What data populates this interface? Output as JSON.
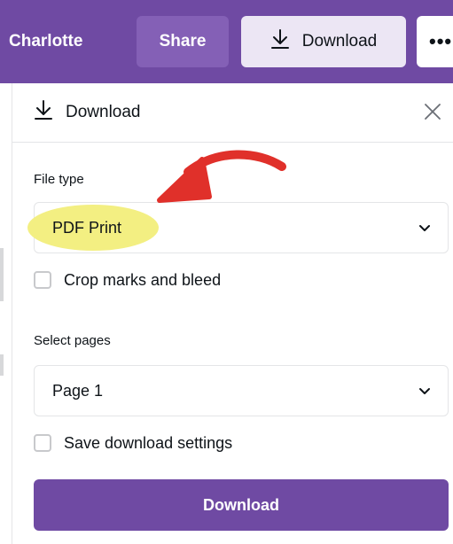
{
  "toolbar": {
    "user_label": "Charlotte",
    "share_label": "Share",
    "download_label": "Download",
    "more_label": "•••",
    "download_icon": "download-arrow-icon"
  },
  "panel": {
    "title": "Download",
    "title_icon": "download-arrow-icon",
    "close_icon": "close-icon",
    "file_type_label": "File type",
    "file_type_value": "PDF Print",
    "crop_marks_label": "Crop marks and bleed",
    "crop_marks_checked": false,
    "select_pages_label": "Select pages",
    "select_pages_value": "Page 1",
    "save_settings_label": "Save download settings",
    "save_settings_checked": false,
    "download_button_label": "Download"
  },
  "annotations": {
    "highlight_color": "#f3ef82",
    "arrow_color": "#e0302a",
    "arrow_icon": "red-curved-arrow"
  },
  "colors": {
    "brand_purple": "#6f4aa3",
    "share_bg": "#8460b6",
    "download_bg": "#ece6f4"
  }
}
